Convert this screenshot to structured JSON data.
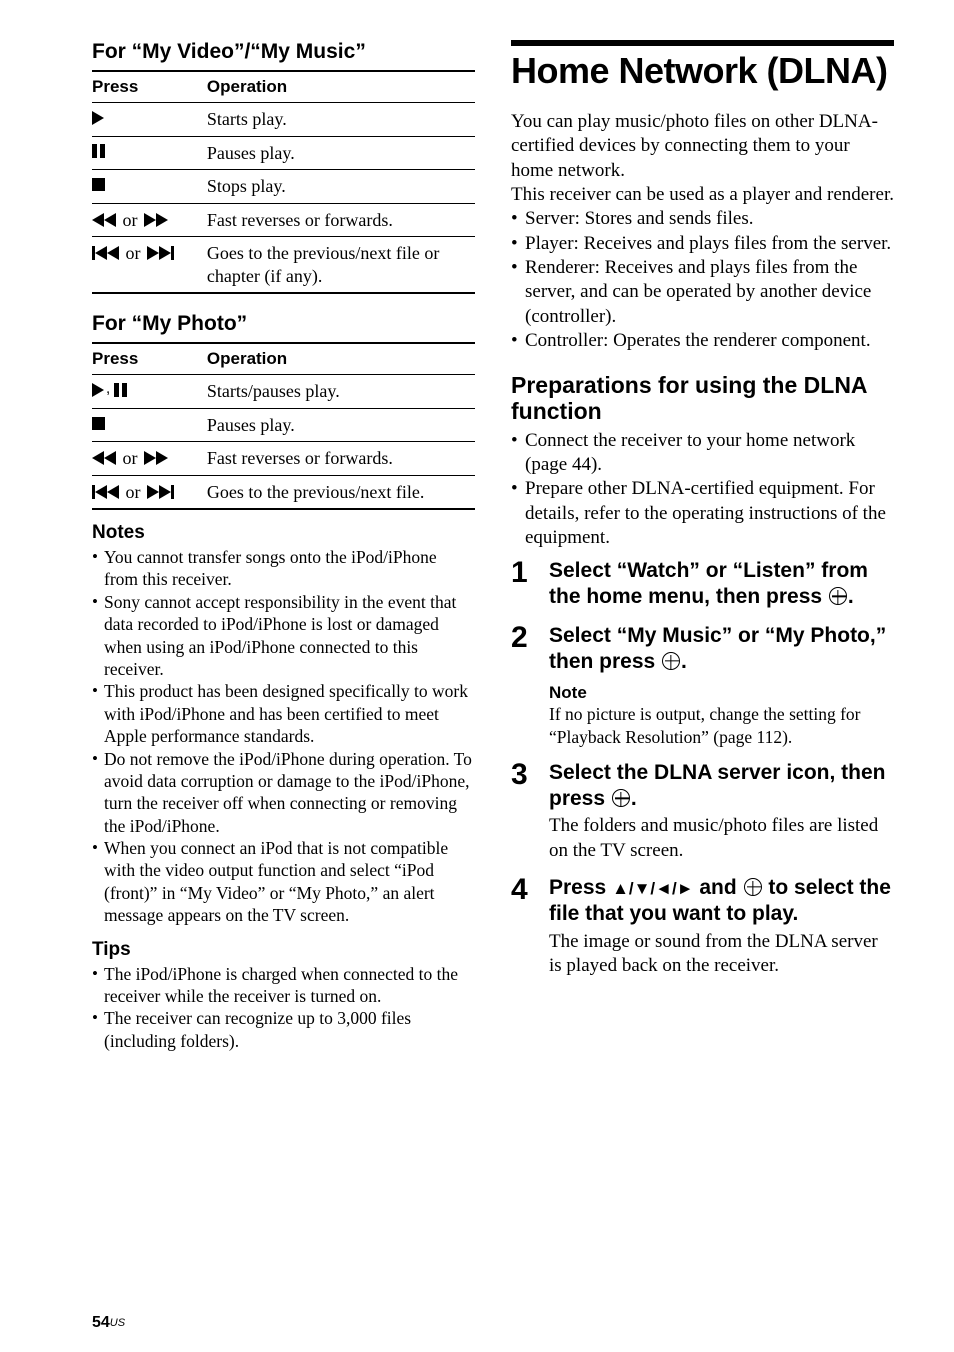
{
  "left": {
    "heading_vm": "For “My Video”/“My Music”",
    "heading_photo": "For “My Photo”",
    "th_press": "Press",
    "th_op": "Operation",
    "tbl_vm": [
      {
        "key_icon": "play",
        "op": "Starts play."
      },
      {
        "key_icon": "pause",
        "op": "Pauses play."
      },
      {
        "key_icon": "stop",
        "op": "Stops play."
      },
      {
        "key_icon": "rew_or_ff",
        "op": "Fast reverses or forwards."
      },
      {
        "key_icon": "prev_or_next",
        "op": "Goes to the previous/next file or chapter (if any)."
      }
    ],
    "tbl_photo": [
      {
        "key_icon": "play_pause",
        "op": "Starts/pauses play."
      },
      {
        "key_icon": "stop",
        "op": "Pauses play."
      },
      {
        "key_icon": "rew_or_ff",
        "op": "Fast reverses or forwards."
      },
      {
        "key_icon": "prev_or_next",
        "op": "Goes to the previous/next file."
      }
    ],
    "notes_h": "Notes",
    "notes": [
      "You cannot transfer songs onto the iPod/iPhone from this receiver.",
      "Sony cannot accept responsibility in the event that data recorded to iPod/iPhone is lost or damaged when using an iPod/iPhone connected to this receiver.",
      "This product has been designed specifically to work with iPod/iPhone and has been certified to meet Apple performance standards.",
      "Do not remove the iPod/iPhone during operation. To avoid data corruption or damage to the iPod/iPhone, turn the receiver off when connecting or removing the iPod/iPhone.",
      "When you connect an iPod that is not compatible with the video output function and select “iPod (front)” in “My Video” or “My Photo,” an alert message appears on the TV screen."
    ],
    "tips_h": "Tips",
    "tips": [
      "The iPod/iPhone is charged when connected to the receiver while the receiver is turned on.",
      "The receiver can recognize up to 3,000 files (including folders)."
    ]
  },
  "right": {
    "title": "Home Network (DLNA)",
    "intro": "You can play music/photo files on other DLNA-certified devices by connecting them to your home network.\nThis receiver can be used as a player and renderer.",
    "roles": [
      "Server: Stores and sends files.",
      "Player: Receives and plays files from the server.",
      "Renderer: Receives and plays files from the server, and can be operated by another device (controller).",
      "Controller: Operates the renderer component."
    ],
    "prep_h": "Preparations for using the DLNA function",
    "prep": [
      "Connect the receiver to your home network (page 44).",
      "Prepare other DLNA-certified equipment. For details, refer to the operating instructions of the equipment."
    ],
    "steps": [
      {
        "head_pre": "Select “Watch” or “Listen” from the home menu, then press ",
        "head_post": "."
      },
      {
        "head_pre": "Select “My Music” or “My Photo,” then press ",
        "head_post": ".",
        "note_h": "Note",
        "note": "If no picture is output, change the setting for “Playback Resolution” (page 112)."
      },
      {
        "head_pre": "Select the DLNA server icon, then press ",
        "head_post": ".",
        "body": "The folders and music/photo files are listed on the TV screen."
      },
      {
        "head_pre": "Press ",
        "head_mid": " and ",
        "head_post": " to select the file that you want to play.",
        "arrows": true,
        "body": "The image or sound from the DLNA server is played back on the receiver."
      }
    ]
  },
  "or_text": " or ",
  "page_num": "54",
  "page_region": "US"
}
